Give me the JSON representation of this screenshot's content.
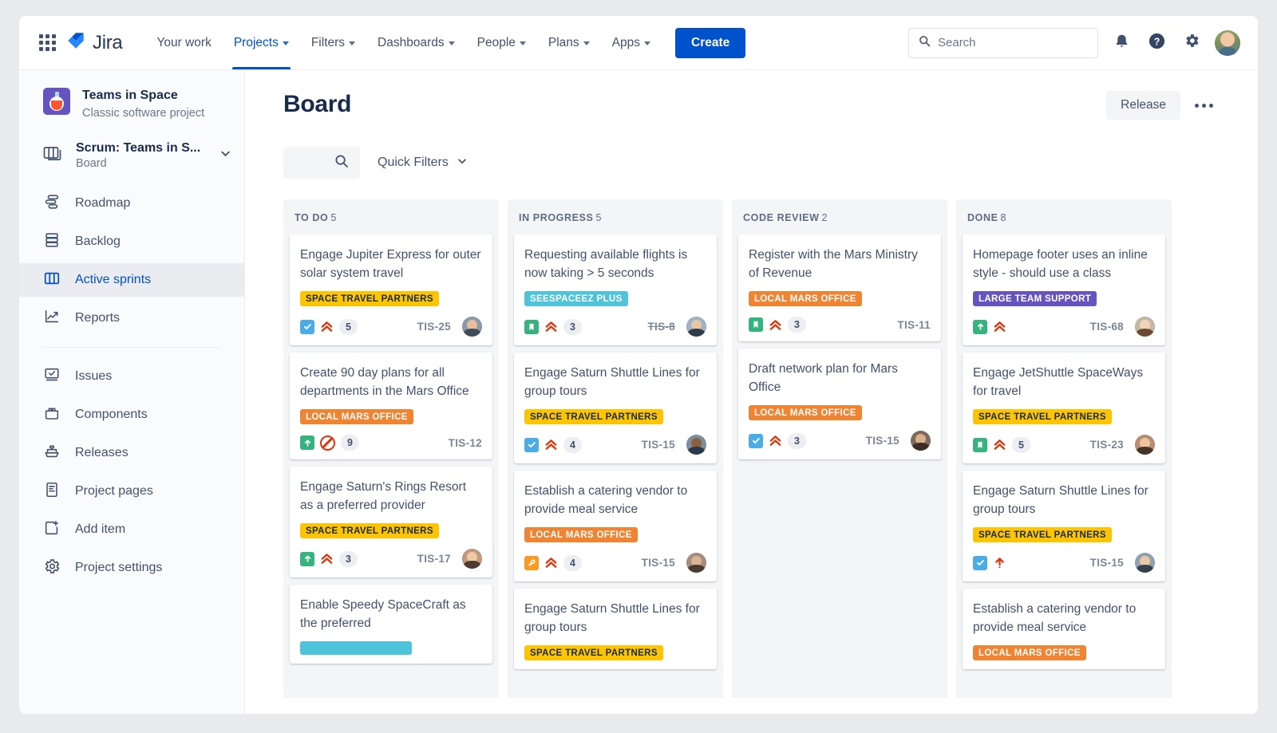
{
  "topnav": {
    "app_switcher_icon": "grid-apps-icon",
    "brand": "Jira",
    "brand_icon": "jira-logo-icon",
    "items": [
      {
        "label": "Your work",
        "has_caret": false,
        "active": false
      },
      {
        "label": "Projects",
        "has_caret": true,
        "active": true
      },
      {
        "label": "Filters",
        "has_caret": true,
        "active": false
      },
      {
        "label": "Dashboards",
        "has_caret": true,
        "active": false
      },
      {
        "label": "People",
        "has_caret": true,
        "active": false
      },
      {
        "label": "Plans",
        "has_caret": true,
        "active": false
      },
      {
        "label": "Apps",
        "has_caret": true,
        "active": false
      }
    ],
    "create_label": "Create",
    "search_placeholder": "Search",
    "search_value": "",
    "notifications_icon": "bell-icon",
    "help_icon": "help-circle-icon",
    "settings_icon": "gear-icon",
    "profile_icon": "user-avatar"
  },
  "sidebar": {
    "project_name": "Teams in Space",
    "project_type": "Classic software project",
    "project_avatar_icon": "flask-project-icon",
    "board_name": "Scrum: Teams in S...",
    "board_type": "Board",
    "board_icon": "board-stack-icon",
    "board_expand_icon": "chevron-down-icon",
    "items_top": [
      {
        "label": "Roadmap",
        "icon": "roadmap-icon",
        "active": false
      },
      {
        "label": "Backlog",
        "icon": "backlog-icon",
        "active": false
      },
      {
        "label": "Active sprints",
        "icon": "board-columns-icon",
        "active": true
      },
      {
        "label": "Reports",
        "icon": "reports-chart-icon",
        "active": false
      }
    ],
    "items_bottom": [
      {
        "label": "Issues",
        "icon": "issues-icon",
        "active": false
      },
      {
        "label": "Components",
        "icon": "components-icon",
        "active": false
      },
      {
        "label": "Releases",
        "icon": "releases-ship-icon",
        "active": false
      },
      {
        "label": "Project pages",
        "icon": "page-doc-icon",
        "active": false
      },
      {
        "label": "Add item",
        "icon": "add-item-plus-icon",
        "active": false
      },
      {
        "label": "Project settings",
        "icon": "gear-icon",
        "active": false
      }
    ]
  },
  "main": {
    "page_title": "Board",
    "release_label": "Release",
    "more_icon": "ellipsis-icon",
    "board_search_icon": "search-icon",
    "board_search_value": "",
    "quick_filters_label": "Quick Filters",
    "quick_filters_caret_icon": "chevron-down-icon"
  },
  "board": {
    "columns": [
      {
        "name": "TO DO",
        "count": "5",
        "cards": [
          {
            "title": "Engage Jupiter Express for outer solar system travel",
            "labels": [
              {
                "text": "Space Travel Partners",
                "color": "yellow"
              }
            ],
            "type_icon": "story-icon",
            "type": "story",
            "priority_icon": "highest-priority-icon",
            "priority": "highest",
            "points": "5",
            "key": "TIS-25",
            "key_done": false,
            "avatar": "assignee-avatar",
            "avatar_colors": {
              "bg": "#8a9aa8",
              "face": "#e8bf9a",
              "shoulders": "#3f4b57"
            }
          },
          {
            "title": "Create 90 day plans for all departments in the Mars Office",
            "labels": [
              {
                "text": "Local Mars Office",
                "color": "orange"
              }
            ],
            "type_icon": "task-icon",
            "type": "task",
            "priority_icon": "blocked-icon",
            "priority": "blocked",
            "points": "9",
            "key": "TIS-12",
            "key_done": false,
            "avatar": null,
            "avatar_colors": null
          },
          {
            "title": "Engage Saturn's Rings Resort as a preferred provider",
            "labels": [
              {
                "text": "Space Travel Partners",
                "color": "yellow"
              }
            ],
            "type_icon": "task-icon",
            "type": "task",
            "priority_icon": "highest-priority-icon",
            "priority": "highest",
            "points": "3",
            "key": "TIS-17",
            "key_done": false,
            "avatar": "assignee-avatar",
            "avatar_colors": {
              "bg": "#c39a7e",
              "face": "#f0caa6",
              "shoulders": "#4e3b32"
            }
          },
          {
            "title": "Enable Speedy SpaceCraft as the preferred",
            "labels": [
              {
                "text": "",
                "color": "teal"
              }
            ],
            "type_icon": null,
            "type": null,
            "priority_icon": null,
            "priority": null,
            "points": null,
            "key": null,
            "key_done": false,
            "avatar": null,
            "avatar_colors": null
          }
        ]
      },
      {
        "name": "IN PROGRESS",
        "count": "5",
        "cards": [
          {
            "title": "Requesting available flights is now taking > 5 seconds",
            "labels": [
              {
                "text": "SeeSpaceEZ Plus",
                "color": "teal"
              }
            ],
            "type_icon": "bookmark-icon",
            "type": "task",
            "priority_icon": "highest-priority-icon",
            "priority": "highest",
            "points": "3",
            "key": "TIS-8",
            "key_done": true,
            "avatar": "assignee-avatar",
            "avatar_colors": {
              "bg": "#9fb4c4",
              "face": "#e9c6a4",
              "shoulders": "#2f3b47"
            }
          },
          {
            "title": "Engage Saturn Shuttle Lines for group tours",
            "labels": [
              {
                "text": "Space Travel Partners",
                "color": "yellow"
              }
            ],
            "type_icon": "story-icon",
            "type": "story",
            "priority_icon": "highest-priority-icon",
            "priority": "highest",
            "points": "4",
            "key": "TIS-15",
            "key_done": false,
            "avatar": "assignee-avatar",
            "avatar_colors": {
              "bg": "#7e8f9c",
              "face": "#8a6040",
              "shoulders": "#2a3a4a"
            }
          },
          {
            "title": "Establish a catering vendor to provide meal service",
            "labels": [
              {
                "text": "Local Mars Office",
                "color": "orange"
              }
            ],
            "type_icon": "improvement-icon",
            "type": "improvement",
            "priority_icon": "highest-priority-icon",
            "priority": "highest",
            "points": "4",
            "key": "TIS-15",
            "key_done": false,
            "avatar": "assignee-avatar",
            "avatar_colors": {
              "bg": "#a48f7d",
              "face": "#d9b394",
              "shoulders": "#4a3b30"
            }
          },
          {
            "title": "Engage Saturn Shuttle Lines for group tours",
            "labels": [
              {
                "text": "Space Travel Partners",
                "color": "yellow"
              }
            ],
            "type_icon": null,
            "type": null,
            "priority_icon": null,
            "priority": null,
            "points": null,
            "key": null,
            "key_done": false,
            "avatar": null,
            "avatar_colors": null
          }
        ]
      },
      {
        "name": "CODE REVIEW",
        "count": "2",
        "cards": [
          {
            "title": "Register with the Mars Ministry of Revenue",
            "labels": [
              {
                "text": "Local Mars Office",
                "color": "orange"
              }
            ],
            "type_icon": "bookmark-icon",
            "type": "task",
            "priority_icon": "highest-priority-icon",
            "priority": "highest",
            "points": "3",
            "key": "TIS-11",
            "key_done": false,
            "avatar": null,
            "avatar_colors": null
          },
          {
            "title": "Draft network plan for Mars Office",
            "labels": [
              {
                "text": "Local Mars Office",
                "color": "orange"
              }
            ],
            "type_icon": "story-icon",
            "type": "story",
            "priority_icon": "highest-priority-icon",
            "priority": "highest",
            "points": "3",
            "key": "TIS-15",
            "key_done": false,
            "avatar": "assignee-avatar",
            "avatar_colors": {
              "bg": "#7d6b5d",
              "face": "#d8b08c",
              "shoulders": "#3a2d24"
            }
          }
        ]
      },
      {
        "name": "DONE",
        "count": "8",
        "cards": [
          {
            "title": "Homepage footer uses an inline style - should use a class",
            "labels": [
              {
                "text": "Large Team Support",
                "color": "purple"
              }
            ],
            "type_icon": "task-icon",
            "type": "task",
            "priority_icon": "highest-priority-icon",
            "priority": "highest",
            "points": null,
            "key": "TIS-68",
            "key_done": false,
            "avatar": "assignee-avatar",
            "avatar_colors": {
              "bg": "#c7b8a6",
              "face": "#f2d3b5",
              "shoulders": "#6b4a36"
            }
          },
          {
            "title": "Engage JetShuttle SpaceWays for travel",
            "labels": [
              {
                "text": "Space Travel Partners",
                "color": "yellow"
              }
            ],
            "type_icon": "bookmark-icon",
            "type": "task",
            "priority_icon": "highest-priority-icon",
            "priority": "highest",
            "points": "5",
            "key": "TIS-23",
            "key_done": false,
            "avatar": "assignee-avatar",
            "avatar_colors": {
              "bg": "#b98f74",
              "face": "#f0c4a0",
              "shoulders": "#46342a"
            }
          },
          {
            "title": "Engage Saturn Shuttle Lines for group tours",
            "labels": [
              {
                "text": "Space Travel Partners",
                "color": "yellow"
              }
            ],
            "type_icon": "story-icon",
            "type": "story",
            "priority_icon": "high-priority-arrow-icon",
            "priority": "high",
            "points": null,
            "key": "TIS-15",
            "key_done": false,
            "avatar": "assignee-avatar",
            "avatar_colors": {
              "bg": "#8fa3b2",
              "face": "#eac7a5",
              "shoulders": "#33414f"
            }
          },
          {
            "title": "Establish a catering vendor to provide meal service",
            "labels": [
              {
                "text": "Local Mars Office",
                "color": "orange"
              }
            ],
            "type_icon": null,
            "type": null,
            "priority_icon": null,
            "priority": null,
            "points": null,
            "key": null,
            "key_done": false,
            "avatar": null,
            "avatar_colors": null
          }
        ]
      }
    ]
  },
  "colors": {
    "brand_blue": "#0052cc",
    "label_yellow": "#ffc400",
    "label_orange": "#ef8433",
    "label_teal": "#4dc4d9",
    "label_purple": "#6554c0",
    "priority_red": "#de350b",
    "column_bg": "#f4f5f7"
  }
}
